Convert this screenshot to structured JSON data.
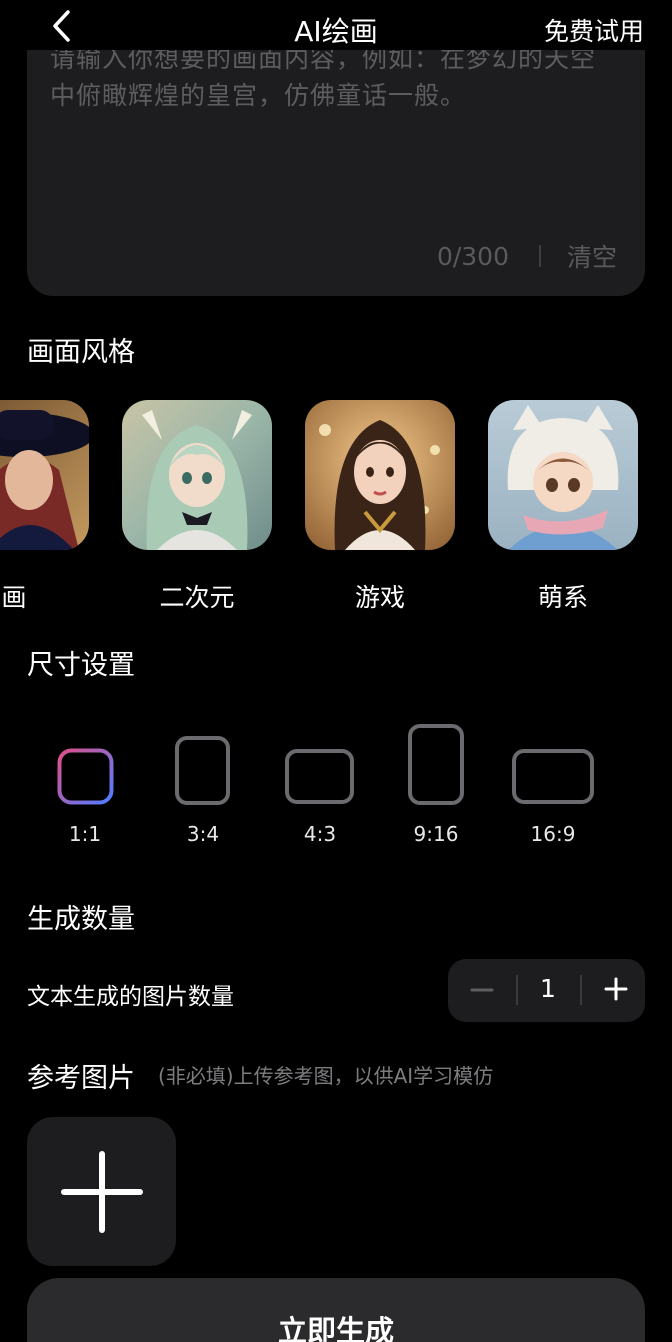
{
  "header": {
    "title": "AI绘画",
    "trial_label": "免费试用"
  },
  "prompt": {
    "placeholder": "请输入你想要的画面内容，例如：在梦幻的天空中俯瞰辉煌的皇宫，仿佛童话一般。",
    "counter": "0/300",
    "clear_label": "清空"
  },
  "styles": {
    "title": "画面风格",
    "items": [
      {
        "label": "画",
        "icon": "portrait-hat-thumbnail"
      },
      {
        "label": "二次元",
        "icon": "anime-girl-thumbnail"
      },
      {
        "label": "游戏",
        "icon": "game-girl-thumbnail"
      },
      {
        "label": "萌系",
        "icon": "cute-child-thumbnail"
      }
    ]
  },
  "size": {
    "title": "尺寸设置",
    "options": [
      "1:1",
      "3:4",
      "4:3",
      "9:16",
      "16:9"
    ],
    "selected": "1:1"
  },
  "count": {
    "title": "生成数量",
    "label": "文本生成的图片数量",
    "value": "1"
  },
  "reference": {
    "title": "参考图片",
    "hint": "(非必填)上传参考图，以供AI学习模仿"
  },
  "generate_label": "立即生成",
  "colors": {
    "background": "#000000",
    "panel": "#1d1d1f",
    "selected_gradient_start": "#e0508a",
    "selected_gradient_end": "#4f7cff"
  }
}
